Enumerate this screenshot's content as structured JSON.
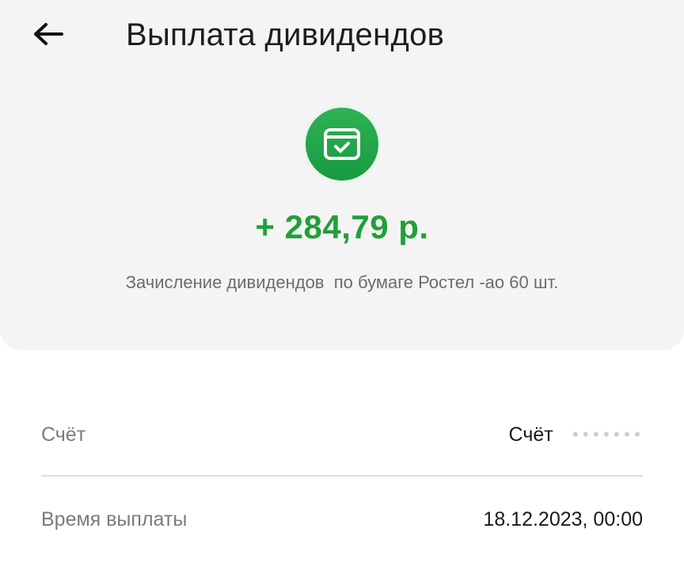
{
  "header": {
    "title": "Выплата дивидендов",
    "back_icon": "arrow-left-icon"
  },
  "summary": {
    "icon": "wallet-check-icon",
    "icon_color": "#21a038",
    "amount": "+ 284,79 р.",
    "amount_color": "#21a038",
    "description": "Зачисление дивидендов  по бумаге Ростел -ао 60 шт."
  },
  "details": [
    {
      "label": "Счёт",
      "value": "Счёт",
      "masked_suffix": "•••••••"
    },
    {
      "label": "Время выплаты",
      "value": "18.12.2023, 00:00"
    }
  ]
}
